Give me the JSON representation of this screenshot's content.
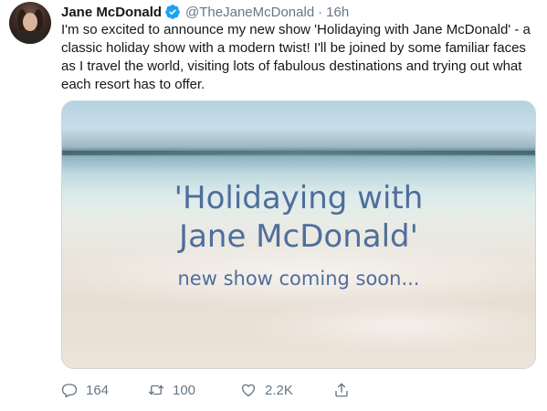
{
  "tweet": {
    "author": {
      "name": "Jane McDonald",
      "handle": "@TheJaneMcDonald",
      "verified": true
    },
    "separator": "·",
    "time": "16h",
    "text": "I'm so excited to announce my new show 'Holidaying with Jane McDonald' - a classic holiday show with a modern twist! I'll be joined by some familiar faces as I travel the world, visiting lots of fabulous destinations and trying out what each resort has to offer.",
    "media": {
      "title_line1": "'Holidaying with",
      "title_line2": "Jane McDonald'",
      "subtitle": "new show coming soon..."
    },
    "actions": {
      "reply_count": "164",
      "retweet_count": "100",
      "like_count": "2.2K"
    }
  },
  "colors": {
    "text_primary": "#14171a",
    "text_secondary": "#657786",
    "verified_blue": "#1da1f2",
    "media_text": "#4f6e9c",
    "border": "#ccd6dd"
  },
  "icons": {
    "reply": "reply-icon",
    "retweet": "retweet-icon",
    "like": "heart-icon",
    "share": "share-icon",
    "verified": "verified-badge-icon"
  }
}
